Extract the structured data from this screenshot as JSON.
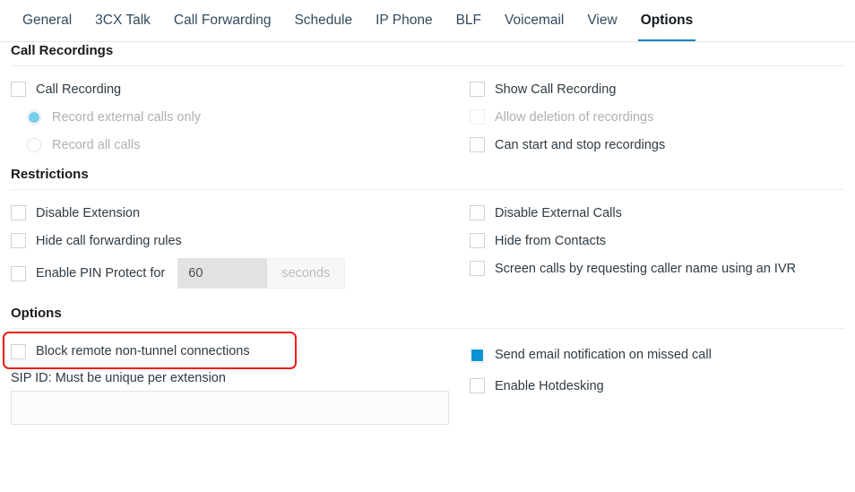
{
  "tabs": [
    {
      "label": "General",
      "active": false
    },
    {
      "label": "3CX Talk",
      "active": false
    },
    {
      "label": "Call Forwarding",
      "active": false
    },
    {
      "label": "Schedule",
      "active": false
    },
    {
      "label": "IP Phone",
      "active": false
    },
    {
      "label": "BLF",
      "active": false
    },
    {
      "label": "Voicemail",
      "active": false
    },
    {
      "label": "View",
      "active": false
    },
    {
      "label": "Options",
      "active": true
    }
  ],
  "sections": {
    "call_recordings": {
      "title": "Call Recordings",
      "left": {
        "call_recording": "Call Recording",
        "record_external": "Record external calls only",
        "record_all": "Record all calls"
      },
      "right": {
        "show_call_recording": "Show Call Recording",
        "allow_deletion": "Allow deletion of recordings",
        "can_start_stop": "Can start and stop recordings"
      }
    },
    "restrictions": {
      "title": "Restrictions",
      "left": {
        "disable_extension": "Disable Extension",
        "hide_call_forwarding": "Hide call forwarding rules",
        "enable_pin": "Enable PIN Protect for",
        "pin_value": "60",
        "pin_units": "seconds"
      },
      "right": {
        "disable_external": "Disable External Calls",
        "hide_from_contacts": "Hide from Contacts",
        "screen_calls": "Screen calls by requesting caller name using an IVR"
      }
    },
    "options": {
      "title": "Options",
      "left": {
        "block_remote": "Block remote non-tunnel connections",
        "sip_id_label": "SIP ID: Must be unique per extension",
        "sip_id_value": "",
        "sip_id_placeholder": ""
      },
      "right": {
        "send_email": "Send email notification on missed call",
        "enable_hotdesking": "Enable Hotdesking"
      }
    }
  },
  "colors": {
    "accent": "#0a84c1",
    "checkbox_checked": "#0a93d4",
    "radio_selected": "#76cdec",
    "annotation": "#ee1c15"
  }
}
